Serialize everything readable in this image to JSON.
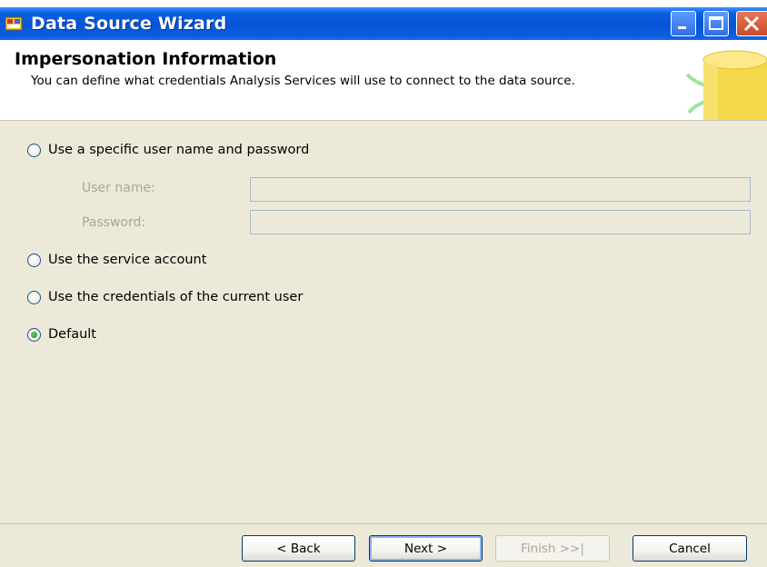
{
  "window": {
    "title": "Data Source Wizard",
    "buttons": {
      "minimize": "minimize",
      "maximize": "maximize",
      "close": "close"
    }
  },
  "header": {
    "title": "Impersonation Information",
    "description": "You can define what credentials Analysis Services will use to connect to the data source."
  },
  "options": {
    "specific_user": {
      "label": "Use a specific user name and password",
      "selected": false
    },
    "service_account": {
      "label": "Use the service account",
      "selected": false
    },
    "current_user": {
      "label": "Use the credentials of the current user",
      "selected": false
    },
    "default": {
      "label": "Default",
      "selected": true
    }
  },
  "fields": {
    "username": {
      "label": "User name:",
      "value": "",
      "disabled": true
    },
    "password": {
      "label": "Password:",
      "value": "",
      "disabled": true
    }
  },
  "footer": {
    "back": "< Back",
    "next": "Next >",
    "finish": "Finish >>|",
    "cancel": "Cancel"
  },
  "colors": {
    "titlebar": "#0655d6",
    "panel": "#ece9d8",
    "radio_selected": "#1e8a1e"
  },
  "icons": {
    "window": "wizard-app-icon",
    "header": "database-cylinder-icon"
  }
}
